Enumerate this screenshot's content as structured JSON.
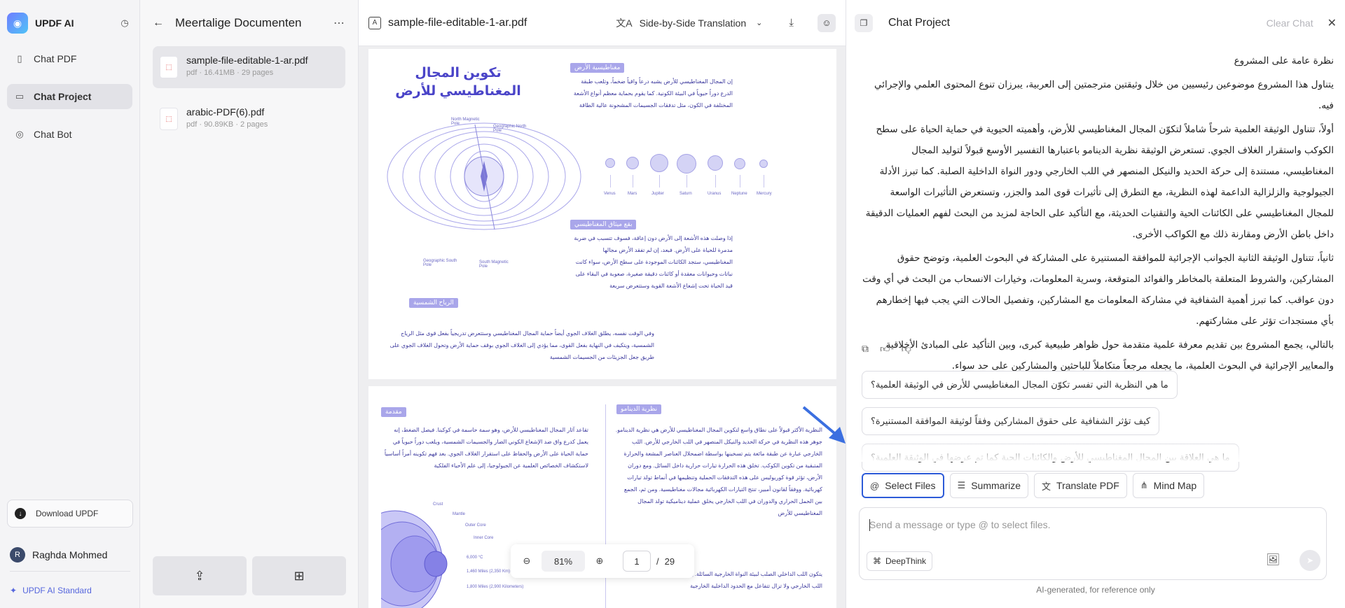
{
  "sidebar": {
    "app_name": "UPDF AI",
    "nav": [
      {
        "label": "Chat PDF",
        "icon": "document-icon"
      },
      {
        "label": "Chat Project",
        "icon": "project-icon"
      },
      {
        "label": "Chat Bot",
        "icon": "bot-icon"
      }
    ],
    "download_label": "Download UPDF",
    "user_initial": "R",
    "user_name": "Raghda Mohmed",
    "plan": "UPDF AI Standard"
  },
  "project": {
    "title": "Meertalige Documenten",
    "files": [
      {
        "name": "sample-file-editable-1-ar.pdf",
        "meta": "pdf · 16.41MB · 29 pages"
      },
      {
        "name": "arabic-PDF(6).pdf",
        "meta": "pdf · 90.89KB · 2 pages"
      }
    ]
  },
  "viewer": {
    "file_name": "sample-file-editable-1-ar.pdf",
    "translation_mode": "Side-by-Side Translation",
    "zoom": "81%",
    "page_current": "1",
    "page_total": "29",
    "page1": {
      "title_line1": "تكوين المجال",
      "title_line2": "المغناطيسي للأرض",
      "tag_mag": "مغناطيسية الأرض",
      "tag_sun": "بقع ميثاق المغناطيسي",
      "tag_wind": "الرياح الشمسية",
      "para_mag": "إن المجال المغناطيسي للأرض يشبه درعاً واقياً ضخماً، وتلعب طبقة الدرع دوراً حيوياً في البيئة الكونية. كما يقوم بحماية معظم أنواع الأشعة المختلفة في الكون، مثل تدفقات الجسيمات المشحونة عالية الطاقة",
      "para_sun": "إذا وصلت هذه الأشعة إلى الأرض دون إعاقة، فسوف تتسبب في ضربة مدمرة للحياة على الأرض. فبعد، إن لم تفقد الأرض مجالها المغناطيسي، ستجد الكائنات الموجودة على سطح الأرض، سواء كانت نباتات وحيوانات معقدة أو كائنات دقيقة صغيرة، صعوبة في البقاء على قيد الحياة تحت إشعاع الأشعة القوية وستتعرض سريعة",
      "para_wind": "وفي الوقت نفسه، يطلق الغلاف الجوي أيضاً حماية المجال المغناطيسي وستتعرض تدريجياً بفعل قوى مثل الرياح الشمسية، ويتكيف في النهاية بفعل القوى، مما يؤدي إلى الغلاف الجوي بوقف حماية الأرض وتحول الغلاف الجوي على طريق جعل الجزيئات من الجسيمات الشمسية",
      "north_magnetic": "North Magnetic Pole",
      "geographic_north": "Geographic North Pole",
      "geographic_south": "Geographic South Pole",
      "south_magnetic": "South Magnetic Pole",
      "planets": [
        "Venus",
        "Mars",
        "Jupiter",
        "Saturn",
        "Uranus",
        "Neptune",
        "Mercury"
      ]
    },
    "page2": {
      "tag_intro": "مقدمة",
      "tag_dynamo": "نظرية الدينامو",
      "para_intro": "تقاعد آثار المجال المغناطيسي للأرض، وهو سمة حاسمة في كوكبنا. فيصل الضغط، إنه يعمل كدرع واق ضد الإشعاع الكوني الضار والجسيمات الشمسية، ويلعب دوراً حيوياً في حماية الحياة على الأرض والحفاظ على استقرار الغلاف الجوي. بعد فهم تكوينه أمراً أساسياً لاستكشاف الخصائص العلمية عن الجيولوجيا، إلى علم الأحياء الفلكية",
      "para_dynamo": "النظرية الأكثر قبولاً على نطاق واسع لتكوين المجال المغناطيسي للأرض هي نظرية الدينامو. جوهر هذه النظرية في حركة الحديد والنيكل المنصهر في اللب الخارجي للأرض. اللب الخارجي عبارة عن طبقة مائعة يتم تسخينها بواسطة اضمحلال العناصر المشعة والحرارة المتبقية من تكوين الكوكب. تخلق هذه الحرارة تيارات حرارية داخل السائل. ومع دوران الأرض، تؤثر قوة كوريوليس على هذه التدفقات الحملية وتنظيمها في أنماط تولد تيارات كهربائية. ووفقاً لقانون أمبير، تنتج التيارات الكهربائية مجالات مغناطيسية. ومن ثم، الجمع بين الحمل الحراري والدوران في اللب الخارجي يخلق عملية ديناميكية تولد المجال المغناطيسي للأرض",
      "para_core": "يتكون اللب الداخلي الصلب لبيئة النواة الخارجية السائلة. يمكن أن تؤثر عمليات اللب في اللب الخارجي ولا تزال تتفاعل مع الحدود الداخلية الخارجية",
      "layers": [
        "Crust",
        "Mantle",
        "Outer Core",
        "Inner Core"
      ],
      "temps": [
        "6,000 °C",
        "1,460 Miles (2,350 Km)",
        "1,800 Miles (2,900 Kilometers)"
      ]
    }
  },
  "chat": {
    "title": "Chat Project",
    "clear_label": "Clear Chat",
    "answer": [
      "نظرة عامة على المشروع",
      "يتناول هذا المشروع موضوعين رئيسيين من خلال وثيقتين مترجمتين إلى العربية، يبرزان تنوع المحتوى العلمي والإجرائي فيه.",
      "أولاً، تتناول الوثيقة العلمية شرحاً شاملاً لتكوّن المجال المغناطيسي للأرض، وأهميته الحيوية في حماية الحياة على سطح الكوكب واستقرار الغلاف الجوي. تستعرض الوثيقة نظرية الدينامو باعتبارها التفسير الأوسع قبولاً لتوليد المجال المغناطيسي، مستندة إلى حركة الحديد والنيكل المنصهر في اللب الخارجي ودور النواة الداخلية الصلبة. كما تبرز الأدلة الجيولوجية والزلزالية الداعمة لهذه النظرية، مع التطرق إلى تأثيرات قوى المد والجزر، وتستعرض التأثيرات الواسعة للمجال المغناطيسي على الكائنات الحية والتقنيات الحديثة، مع التأكيد على الحاجة لمزيد من البحث لفهم العمليات الدقيقة داخل باطن الأرض ومقارنة ذلك مع الكواكب الأخرى.",
      "ثانياً، تتناول الوثيقة الثانية الجوانب الإجرائية للموافقة المستنيرة على المشاركة في البحوث العلمية، وتوضح حقوق المشاركين، والشروط المتعلقة بالمخاطر والفوائد المتوقعة، وسرية المعلومات، وخيارات الانسحاب من البحث في أي وقت دون عواقب. كما تبرز أهمية الشفافية في مشاركة المعلومات مع المشاركين، وتفصيل الحالات التي يجب فيها إخطارهم بأي مستجدات تؤثر على مشاركتهم.",
      "بالتالي، يجمع المشروع بين تقديم معرفة علمية متقدمة حول ظواهر طبيعية كبرى، وبين التأكيد على المبادئ الأخلاقية والمعايير الإجرائية في البحوث العلمية، ما يجعله مرجعاً متكاملاً للباحثين والمشاركين على حد سواء."
    ],
    "suggestions": [
      "ما هي النظرية التي تفسر تكوّن المجال المغناطيسي للأرض في الوثيقة العلمية؟",
      "كيف تؤثر الشفافية على حقوق المشاركين وفقاً لوثيقة الموافقة المستنيرة؟",
      "ما هي العلاقة بين المجال المغناطيسي للأرض والكائنات الحية كما تم عرضها في الوثيقة العلمية؟"
    ],
    "tools": [
      "Select Files",
      "Summarize",
      "Translate PDF",
      "Mind Map"
    ],
    "input_placeholder": "Send a message or type @ to select files.",
    "deepthink_label": "DeepThink",
    "footnote": "AI-generated, for reference only"
  },
  "colors": {
    "accent": "#2d5bd8",
    "pdf_text": "#3d3a9e",
    "pdf_tag": "#a9a6ea",
    "brand": "#5566dd"
  }
}
